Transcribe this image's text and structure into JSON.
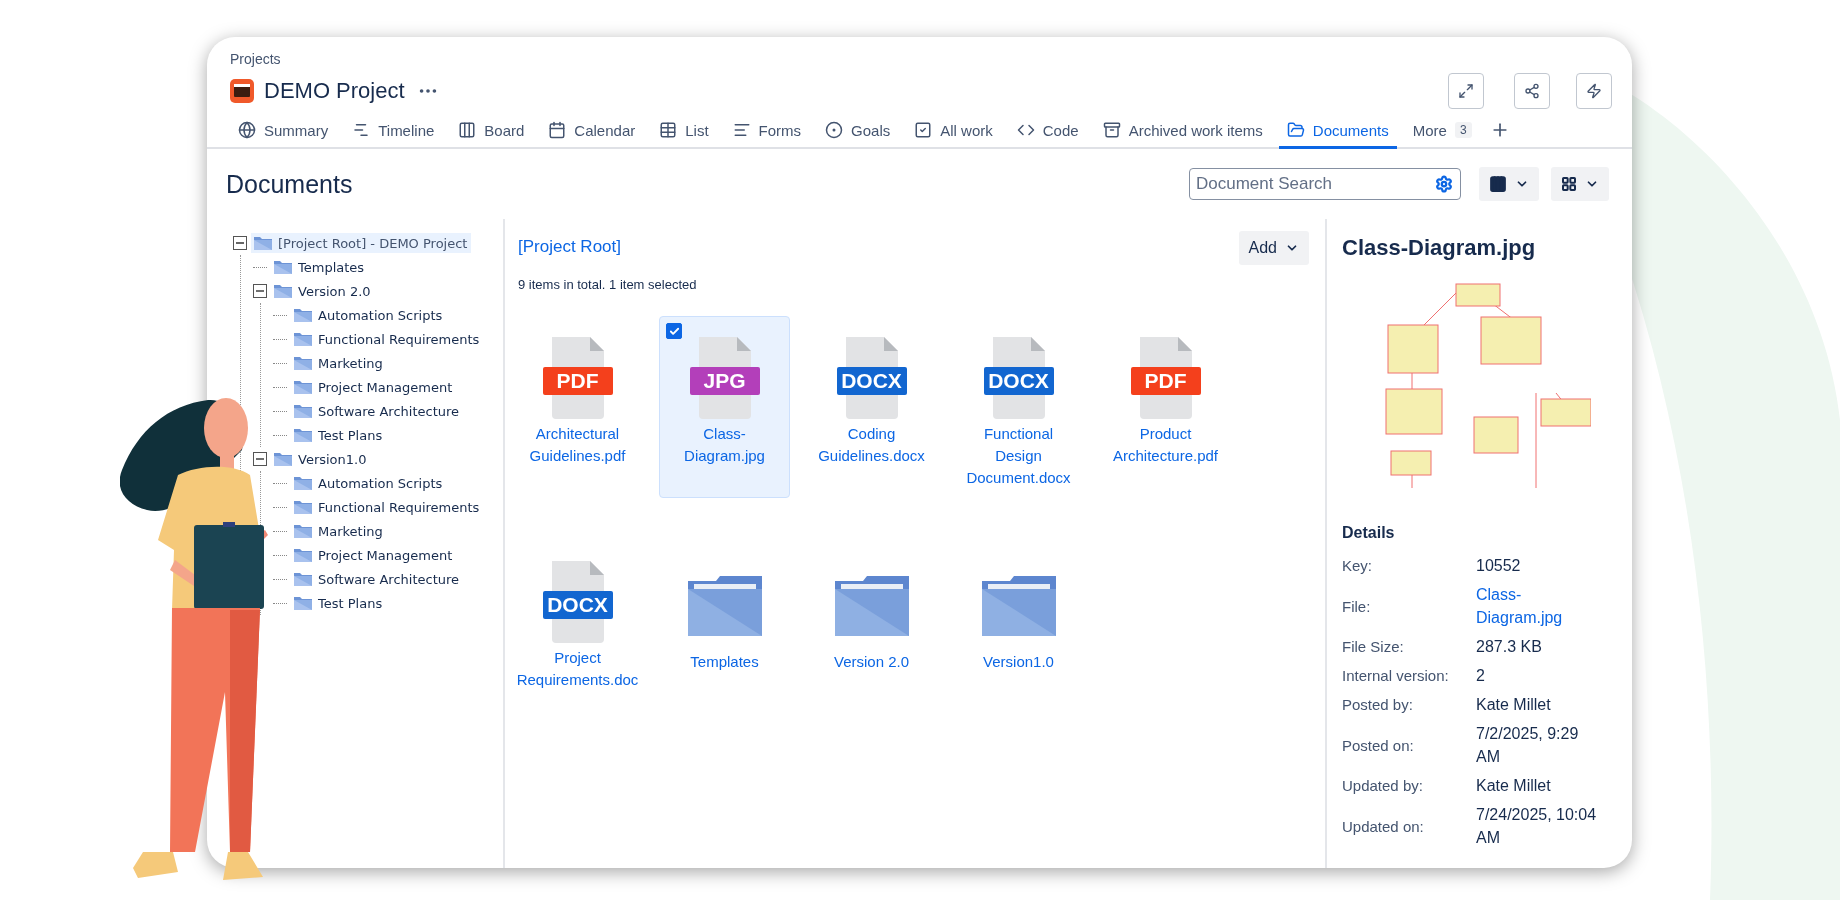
{
  "breadcrumb": "Projects",
  "project": {
    "title": "DEMO Project"
  },
  "tabs": [
    {
      "label": "Summary",
      "selected": false
    },
    {
      "label": "Timeline",
      "selected": false
    },
    {
      "label": "Board",
      "selected": false
    },
    {
      "label": "Calendar",
      "selected": false
    },
    {
      "label": "List",
      "selected": false
    },
    {
      "label": "Forms",
      "selected": false
    },
    {
      "label": "Goals",
      "selected": false
    },
    {
      "label": "All work",
      "selected": false
    },
    {
      "label": "Code",
      "selected": false
    },
    {
      "label": "Archived work items",
      "selected": false
    },
    {
      "label": "Documents",
      "selected": true
    }
  ],
  "more": {
    "label": "More",
    "count": "3"
  },
  "page_title": "Documents",
  "search": {
    "placeholder": "Document Search"
  },
  "tree": [
    {
      "label": "[Project Root] - DEMO Project",
      "selected": true,
      "expanded": true,
      "children": [
        {
          "label": "Templates",
          "selected": false
        },
        {
          "label": "Version 2.0",
          "selected": false,
          "expanded": true,
          "children": [
            {
              "label": "Automation Scripts",
              "selected": false
            },
            {
              "label": "Functional Requirements",
              "selected": false
            },
            {
              "label": "Marketing",
              "selected": false
            },
            {
              "label": "Project Management",
              "selected": false
            },
            {
              "label": "Software Architecture",
              "selected": false
            },
            {
              "label": "Test Plans",
              "selected": false
            }
          ]
        },
        {
          "label": "Version1.0",
          "selected": false,
          "expanded": true,
          "children": [
            {
              "label": "Automation Scripts",
              "selected": false
            },
            {
              "label": "Functional Requirements",
              "selected": false
            },
            {
              "label": "Marketing",
              "selected": false
            },
            {
              "label": "Project Management",
              "selected": false
            },
            {
              "label": "Software Architecture",
              "selected": false
            },
            {
              "label": "Test Plans",
              "selected": false
            }
          ]
        }
      ]
    }
  ],
  "folder": {
    "title": "[Project Root]",
    "summary": "9 items in total. 1 item selected",
    "add_button": "Add"
  },
  "items": [
    {
      "kind": "file",
      "badge": "PDF",
      "color": "#f4401c",
      "name": "Architectural Guidelines.pdf",
      "selected": false
    },
    {
      "kind": "file",
      "badge": "JPG",
      "color": "#b33fba",
      "name": "Class-Diagram.jpg",
      "selected": true
    },
    {
      "kind": "file",
      "badge": "DOCX",
      "color": "#1266d0",
      "name": "Coding Guidelines.docx",
      "selected": false
    },
    {
      "kind": "file",
      "badge": "DOCX",
      "color": "#1266d0",
      "name": "Functional Design Document.docx",
      "selected": false
    },
    {
      "kind": "file",
      "badge": "PDF",
      "color": "#f4401c",
      "name": "Product Architecture.pdf",
      "selected": false
    },
    {
      "kind": "file",
      "badge": "DOCX",
      "color": "#1266d0",
      "name": "Project Requirements.doc",
      "selected": false
    },
    {
      "kind": "folder",
      "name": "Templates",
      "selected": false
    },
    {
      "kind": "folder",
      "name": "Version 2.0",
      "selected": false
    },
    {
      "kind": "folder",
      "name": "Version1.0",
      "selected": false
    }
  ],
  "details": {
    "title": "Class-Diagram.jpg",
    "heading": "Details",
    "rows": [
      {
        "label": "Key:",
        "value": "10552",
        "kind": "text"
      },
      {
        "label": "File:",
        "value": "Class-Diagram.jpg",
        "kind": "link"
      },
      {
        "label": "File Size:",
        "value": "287.3 KB",
        "kind": "text"
      },
      {
        "label": "Internal version:",
        "value": "2",
        "kind": "text"
      },
      {
        "label": "Posted by:",
        "value": "Kate Millet",
        "kind": "text"
      },
      {
        "label": "Posted on:",
        "value": "7/2/2025, 9:29 AM",
        "kind": "text"
      },
      {
        "label": "Updated by:",
        "value": "Kate Millet",
        "kind": "text"
      },
      {
        "label": "Updated on:",
        "value": "7/24/2025, 10:04 AM",
        "kind": "text"
      }
    ]
  }
}
